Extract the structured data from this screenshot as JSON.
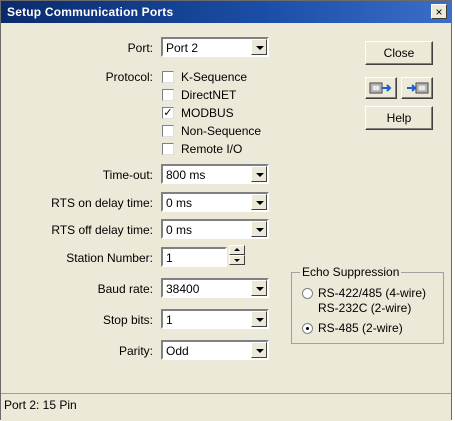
{
  "window": {
    "title": "Setup Communication Ports",
    "close_glyph": "×"
  },
  "port": {
    "label": "Port:",
    "value": "Port 2"
  },
  "protocol": {
    "label": "Protocol:",
    "options": [
      {
        "label": "K-Sequence",
        "checked": false
      },
      {
        "label": "DirectNET",
        "checked": false
      },
      {
        "label": "MODBUS",
        "checked": true
      },
      {
        "label": "Non-Sequence",
        "checked": false
      },
      {
        "label": "Remote I/O",
        "checked": false
      }
    ],
    "check_glyph": "✓"
  },
  "timeout": {
    "label": "Time-out:",
    "value": "800 ms"
  },
  "rts_on": {
    "label": "RTS on delay time:",
    "value": "0 ms"
  },
  "rts_off": {
    "label": "RTS off delay time:",
    "value": "0 ms"
  },
  "station": {
    "label": "Station Number:",
    "value": "1"
  },
  "baud": {
    "label": "Baud rate:",
    "value": "38400"
  },
  "stop_bits": {
    "label": "Stop bits:",
    "value": "1"
  },
  "parity": {
    "label": "Parity:",
    "value": "Odd"
  },
  "buttons": {
    "close": "Close",
    "help": "Help"
  },
  "icons": {
    "send": "transfer-to-plc-icon",
    "receive": "transfer-from-plc-icon"
  },
  "echo": {
    "title": "Echo Suppression",
    "options": [
      {
        "line1": "RS-422/485 (4-wire)",
        "line2": "RS-232C (2-wire)",
        "selected": false
      },
      {
        "line1": "RS-485 (2-wire)",
        "selected": true
      }
    ]
  },
  "status": {
    "text": "Port 2: 15 Pin"
  }
}
